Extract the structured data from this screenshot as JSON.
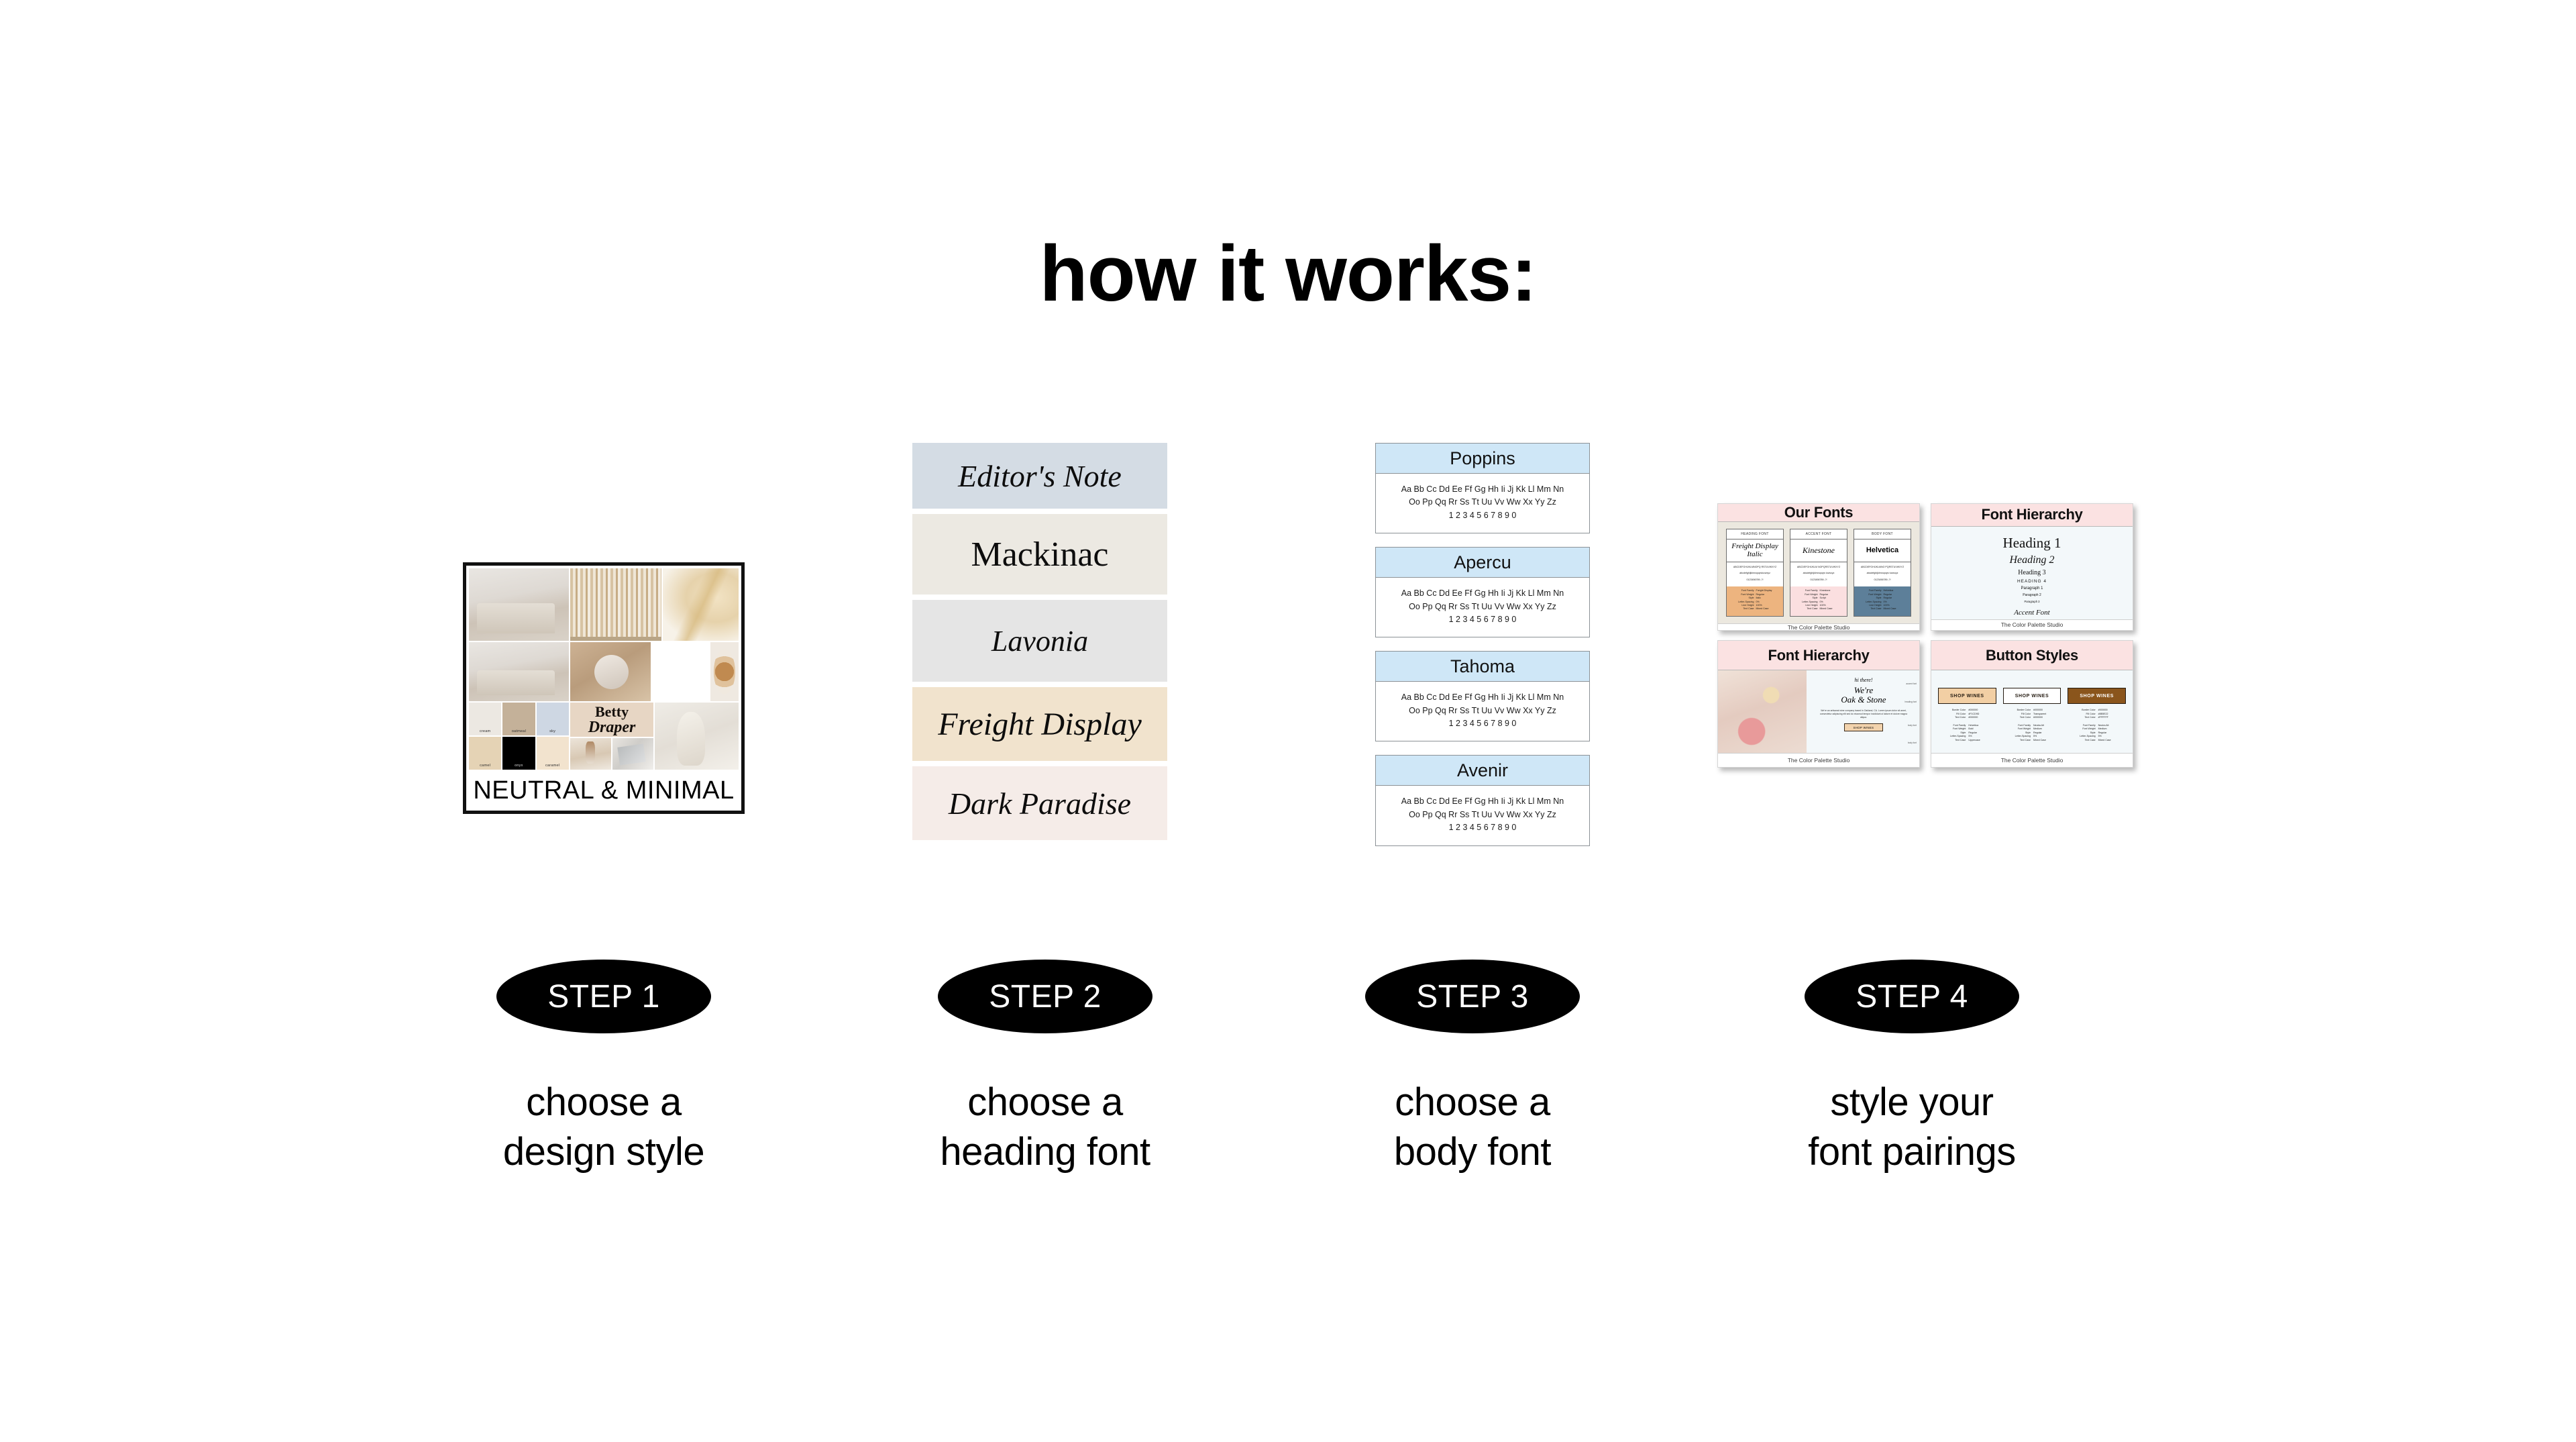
{
  "page": {
    "title": "how it works:"
  },
  "step1": {
    "moodboard": {
      "caption": "NEUTRAL & MINIMAL",
      "note_line1": "Betty",
      "note_line2": "Draper",
      "swatches": [
        {
          "name": "cream",
          "hex": "#ece8e2"
        },
        {
          "name": "oatmeal",
          "hex": "#c4b199"
        },
        {
          "name": "sky",
          "hex": "#ced7e3"
        },
        {
          "name": "camel",
          "hex": "#e5d3b5"
        },
        {
          "name": "onyx",
          "hex": "#000000"
        },
        {
          "name": "caramel",
          "hex": "#f2e3ce"
        }
      ]
    }
  },
  "step2": {
    "fonts": [
      {
        "name": "Editor's Note",
        "bg": "#d4dce4",
        "height": 98,
        "size": 46,
        "style": "italic",
        "weight": "400"
      },
      {
        "name": "Mackinac",
        "bg": "#ece9e2",
        "height": 120,
        "size": 52,
        "style": "normal",
        "weight": "400"
      },
      {
        "name": "Lavonia",
        "bg": "#e5e5e5",
        "height": 122,
        "size": 44,
        "style": "italic",
        "weight": "400"
      },
      {
        "name": "Freight Display",
        "bg": "#f1e3cd",
        "height": 110,
        "size": 48,
        "style": "italic",
        "weight": "400"
      },
      {
        "name": "Dark Paradise",
        "bg": "#f5ece8",
        "height": 110,
        "size": 46,
        "style": "italic",
        "weight": "400"
      }
    ]
  },
  "step3": {
    "specimen": {
      "line1": "Aa Bb Cc Dd Ee Ff Gg Hh Ii Jj Kk Ll Mm Nn",
      "line2": "Oo Pp Qq Rr Ss Tt Uu Vv Ww Xx Yy Zz",
      "line3": "1 2 3 4 5 6 7 8 9 0"
    },
    "cards": [
      {
        "name": "Poppins"
      },
      {
        "name": "Apercu"
      },
      {
        "name": "Tahoma"
      },
      {
        "name": "Avenir"
      }
    ]
  },
  "step4": {
    "footer": "The Color Palette Studio",
    "our_fonts": {
      "title": "Our Fonts",
      "columns": [
        {
          "kind": "HEADING FONT",
          "name": "Freight Display Italic",
          "spec_upper": "ABCDEFGHIJKLMNOPQ RSTUVWXYZ",
          "spec_lower": "abcdefghijklmnopqrstuvwxyz",
          "spec_digits": "0123456789.,?!",
          "meta": [
            {
              "k": "Font Family",
              "v": "Freight Display"
            },
            {
              "k": "Font Weight",
              "v": "Regular"
            },
            {
              "k": "Style",
              "v": "Italic"
            },
            {
              "k": "Letter-Spacing",
              "v": "0%"
            },
            {
              "k": "Line Height",
              "v": "100%"
            },
            {
              "k": "Text Case",
              "v": "Mixed Case"
            }
          ]
        },
        {
          "kind": "ACCENT FONT",
          "name": "Kinestone",
          "spec_upper": "ABCDEFGHIJKLM NOPQRSTUVWXYZ",
          "spec_lower": "abcdefghijklmnopqrs tuvwxyz",
          "spec_digits": "0123456789.,?!",
          "meta": [
            {
              "k": "Font Family",
              "v": "Kinestone"
            },
            {
              "k": "Font Weight",
              "v": "Regular"
            },
            {
              "k": "Style",
              "v": "Script"
            },
            {
              "k": "Letter-Spacing",
              "v": "0%"
            },
            {
              "k": "Line Height",
              "v": "100%"
            },
            {
              "k": "Text Case",
              "v": "Mixed Case"
            }
          ]
        },
        {
          "kind": "BODY FONT",
          "name": "Helvetica",
          "spec_upper": "ABCDEFGHIJKLMNO PQRSTUVWXYZ",
          "spec_lower": "abcdefghijklmnopqrs tuvwxyz",
          "spec_digits": "0123456789.,?!",
          "meta": [
            {
              "k": "Font Family",
              "v": "Helvetica"
            },
            {
              "k": "Font Weight",
              "v": "Regular"
            },
            {
              "k": "Style",
              "v": "Regular"
            },
            {
              "k": "Letter-Spacing",
              "v": "0%"
            },
            {
              "k": "Line Height",
              "v": "100%"
            },
            {
              "k": "Text Case",
              "v": "Mixed Case"
            }
          ]
        }
      ]
    },
    "font_hierarchy": {
      "title": "Font Hierarchy",
      "levels": [
        "Heading 1",
        "Heading 2",
        "Heading 3",
        "HEADING 4",
        "Paragraph 1",
        "Paragraph 2",
        "Paragraph 3"
      ],
      "accent": "Accent Font"
    },
    "font_hierarchy_layout": {
      "title": "Font Hierarchy",
      "greeting": "hi there!",
      "headline_line1": "We're",
      "headline_line2": "Oak & Stone",
      "paragraph": "We're an artisanal wine company based in Oakland, CA. Lorem ipsum dolor sit amet, consectetur adipiscing elit sed do eiusmod tempor incididunt ut labore et dolore magna aliqua.",
      "button": "SHOP WINES",
      "annotations": [
        "accent font",
        "heading font",
        "body font",
        "body font"
      ]
    },
    "button_styles": {
      "title": "Button Styles",
      "buttons": [
        {
          "label": "SHOP WINES",
          "meta": [
            {
              "k": "Border Color",
              "v": "#000000"
            },
            {
              "k": "Fill Color",
              "v": "#F1CD9D"
            },
            {
              "k": "Text Color",
              "v": "#000000"
            },
            {
              "k": "Font Family",
              "v": "Helvetica"
            },
            {
              "k": "Font Weight",
              "v": "Bold"
            },
            {
              "k": "Style",
              "v": "Regular"
            },
            {
              "k": "Letter-Spacing",
              "v": "5%"
            },
            {
              "k": "Text Case",
              "v": "Uppercase"
            }
          ]
        },
        {
          "label": "SHOP WINES",
          "meta": [
            {
              "k": "Border Color",
              "v": "#000000"
            },
            {
              "k": "Fill Color",
              "v": "Transparent"
            },
            {
              "k": "Text Color",
              "v": "#000000"
            },
            {
              "k": "Font Family",
              "v": "Neutra Alt"
            },
            {
              "k": "Font Weight",
              "v": "Medium"
            },
            {
              "k": "Style",
              "v": "Regular"
            },
            {
              "k": "Letter-Spacing",
              "v": "5%"
            },
            {
              "k": "Text Case",
              "v": "Mixed Case"
            }
          ]
        },
        {
          "label": "SHOP WINES",
          "meta": [
            {
              "k": "Border Color",
              "v": "#000000"
            },
            {
              "k": "Fill Color",
              "v": "#8B5E22"
            },
            {
              "k": "Text Color",
              "v": "#FFFFFF"
            },
            {
              "k": "Font Family",
              "v": "Neutra Alt"
            },
            {
              "k": "Font Weight",
              "v": "Medium"
            },
            {
              "k": "Style",
              "v": "Regular"
            },
            {
              "k": "Letter-Spacing",
              "v": "5%"
            },
            {
              "k": "Text Case",
              "v": "Mixed Case"
            }
          ]
        }
      ]
    }
  },
  "steps": [
    {
      "badge": "STEP 1",
      "caption": "choose a\ndesign style"
    },
    {
      "badge": "STEP 2",
      "caption": "choose a\nheading font"
    },
    {
      "badge": "STEP 3",
      "caption": "choose a\nbody font"
    },
    {
      "badge": "STEP 4",
      "caption": "style your\nfont pairings"
    }
  ]
}
